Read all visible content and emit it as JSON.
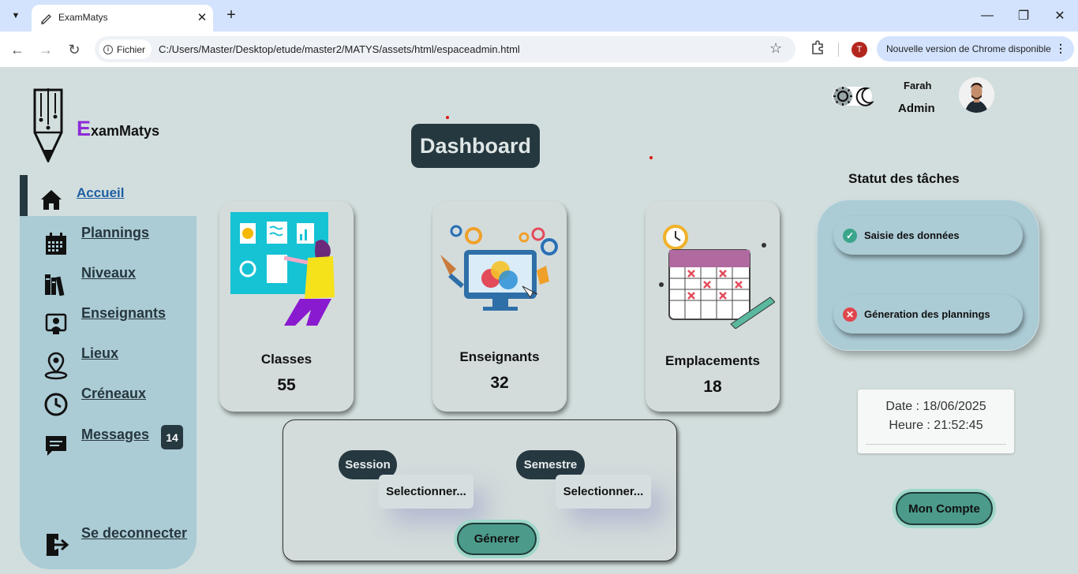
{
  "browser": {
    "tab_title": "ExamMatys",
    "url_chip": "Fichier",
    "url": "C:/Users/Master/Desktop/etude/master2/MATYS/assets/html/espaceadmin.html",
    "profile_initial": "T",
    "update_label": "Nouvelle version de Chrome disponible"
  },
  "brand": {
    "initial": "E",
    "rest": "xamMatys"
  },
  "sidebar": {
    "items": [
      {
        "label": "Accueil",
        "icon": "home-icon"
      },
      {
        "label": "Plannings",
        "icon": "calendar-icon"
      },
      {
        "label": "Niveaux",
        "icon": "books-icon"
      },
      {
        "label": "Enseignants",
        "icon": "teacher-icon"
      },
      {
        "label": "Lieux",
        "icon": "location-pin-icon"
      },
      {
        "label": "Créneaux",
        "icon": "clock-icon"
      },
      {
        "label": "Messages",
        "icon": "message-icon",
        "badge": "14"
      },
      {
        "label": "Se deconnecter",
        "icon": "logout-icon"
      }
    ]
  },
  "dashboard": {
    "title": "Dashboard"
  },
  "cards": [
    {
      "title": "Classes",
      "count": "55"
    },
    {
      "title": "Enseignants",
      "count": "32"
    },
    {
      "title": "Emplacements",
      "count": "18"
    }
  ],
  "generator": {
    "session_label": "Session",
    "session_select": "Selectionner...",
    "semester_label": "Semestre",
    "semester_select": "Selectionner...",
    "generate_button": "Génerer"
  },
  "user": {
    "name": "Farah",
    "role": "Admin"
  },
  "tasks": {
    "title": "Statut des tâches",
    "items": [
      {
        "label": "Saisie des données",
        "status": "done",
        "color": "#3aa58a"
      },
      {
        "label": "Géneration des plannings",
        "status": "failed",
        "color": "#e0474c"
      }
    ]
  },
  "clock": {
    "date": "Date : 18/06/2025",
    "time": "Heure : 21:52:45"
  },
  "account_button": "Mon Compte"
}
